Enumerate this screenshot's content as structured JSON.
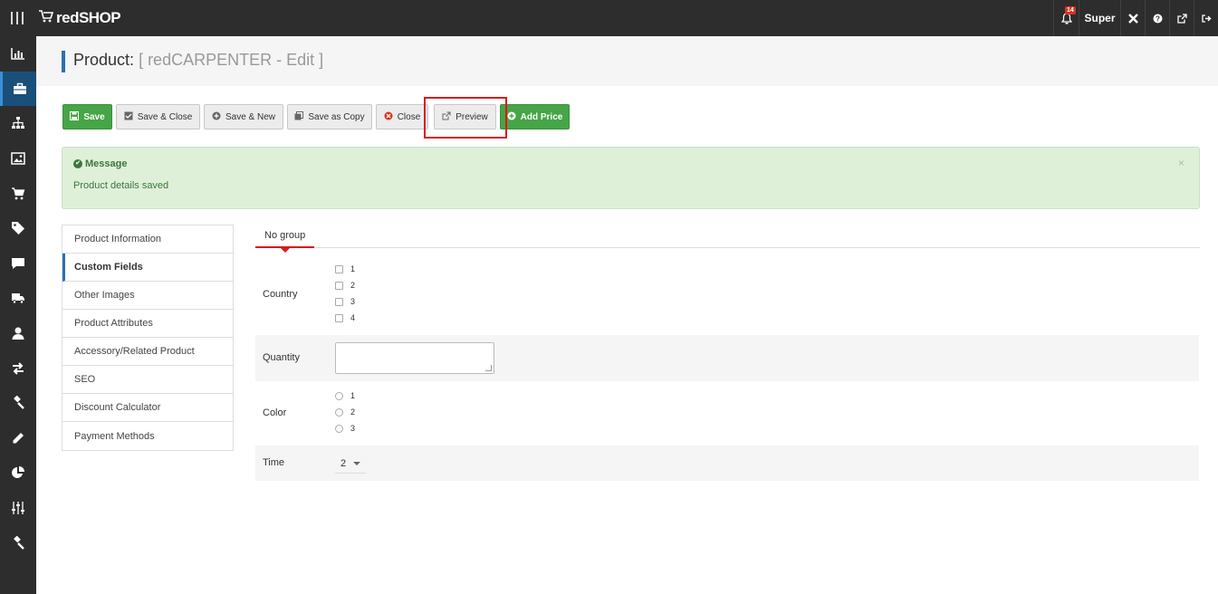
{
  "topbar": {
    "brand": "redSHOP",
    "notifications_count": "14",
    "user": "Super"
  },
  "sidebar": {
    "items": [
      {
        "icon": "bar-chart-icon"
      },
      {
        "icon": "briefcase-icon",
        "active": true
      },
      {
        "icon": "sitemap-icon"
      },
      {
        "icon": "image-icon"
      },
      {
        "icon": "cart-icon"
      },
      {
        "icon": "tag-icon"
      },
      {
        "icon": "comment-icon"
      },
      {
        "icon": "truck-icon"
      },
      {
        "icon": "user-icon"
      },
      {
        "icon": "exchange-icon"
      },
      {
        "icon": "gavel-icon"
      },
      {
        "icon": "pencil-icon"
      },
      {
        "icon": "pie-chart-icon"
      },
      {
        "icon": "sliders-icon"
      },
      {
        "icon": "hammer-icon"
      }
    ]
  },
  "header": {
    "title_main": "Product:",
    "title_sub": "[ redCARPENTER - Edit ]"
  },
  "toolbar": {
    "save": "Save",
    "save_close": "Save & Close",
    "save_new": "Save & New",
    "save_copy": "Save as Copy",
    "close": "Close",
    "preview": "Preview",
    "add_price": "Add Price"
  },
  "message": {
    "heading": "Message",
    "text": "Product details saved",
    "close": "×"
  },
  "tabs": [
    "Product Information",
    "Custom Fields",
    "Other Images",
    "Product Attributes",
    "Accessory/Related Product",
    "SEO",
    "Discount Calculator",
    "Payment Methods"
  ],
  "active_tab": "Custom Fields",
  "group_tab": "No group",
  "fields": {
    "country": {
      "label": "Country",
      "options": [
        "1",
        "2",
        "3",
        "4"
      ]
    },
    "quantity": {
      "label": "Quantity",
      "value": ""
    },
    "color": {
      "label": "Color",
      "options": [
        "1",
        "2",
        "3"
      ]
    },
    "time": {
      "label": "Time",
      "value": "2"
    }
  },
  "colors": {
    "topbar": "#2d2d2d",
    "save_green": "#46a546",
    "message_bg": "#dff0d8",
    "highlight": "#d9191f",
    "accent_blue": "#2a70b5"
  }
}
